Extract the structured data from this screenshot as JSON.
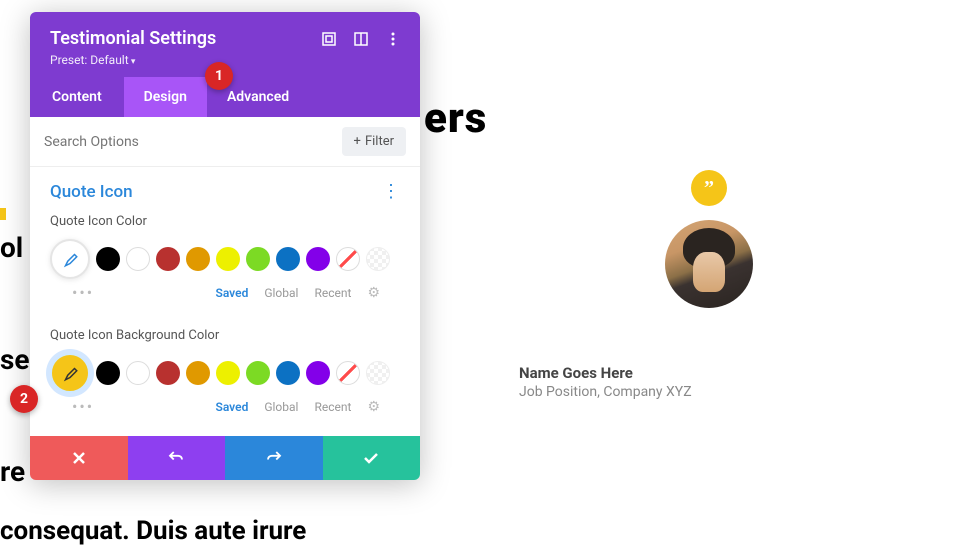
{
  "panel_title": "Testimonial Settings",
  "preset": "Preset: Default",
  "tabs": {
    "content": "Content",
    "design": "Design",
    "advanced": "Advanced"
  },
  "search": {
    "placeholder": "Search Options"
  },
  "filter_label": "Filter",
  "section": {
    "title": "Quote Icon"
  },
  "color_group": {
    "label": "Quote Icon Color"
  },
  "bg_group": {
    "label": "Quote Icon Background Color"
  },
  "palette_tabs": {
    "saved": "Saved",
    "global": "Global",
    "recent": "Recent"
  },
  "markers": {
    "one": "1",
    "two": "2"
  },
  "preview": {
    "name": "Name Goes Here",
    "meta": "Job Position, Company XYZ"
  },
  "bg_text": {
    "ers": "ers",
    "left_lines": "ol\n\nse\n\nre",
    "bottom": "consequat. Duis aute irure"
  },
  "colors": {
    "accent": "#f5c518",
    "primary": "#7e3bd0",
    "active_tab": "#a855f7",
    "link": "#2b87da",
    "marker": "#d92626"
  }
}
